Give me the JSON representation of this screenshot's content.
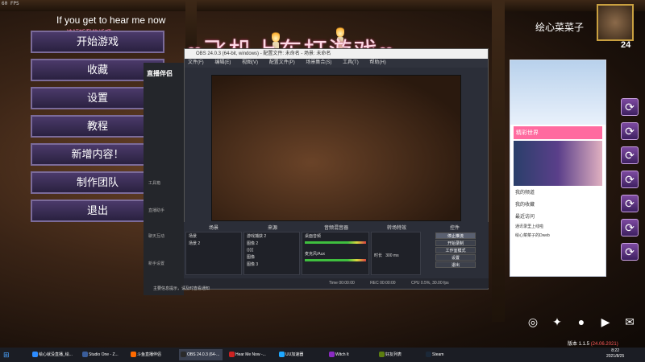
{
  "stream_overlay": {
    "fps": "60 FPS",
    "banner_text": "If you get to hear me now",
    "banner_subtext": "请倾听我的话吧",
    "title": "飞机上车打游戏",
    "player_name": "绘心菜菜子",
    "player_level": "24"
  },
  "game_menu": {
    "items": [
      {
        "label": "开始游戏"
      },
      {
        "label": "收藏"
      },
      {
        "label": "设置"
      },
      {
        "label": "教程"
      },
      {
        "label": "新增内容！"
      },
      {
        "label": "制作团队"
      },
      {
        "label": "退出"
      }
    ]
  },
  "streaming_app": {
    "logo_text": "直播伴侣",
    "nav": [
      "工具箱",
      "直播助手",
      "聊天互动",
      "新手设置"
    ],
    "notice": "主要信息提示，请及时查看通知",
    "stats": [
      "Time 00:00:00",
      "REC 00:00:00",
      "CPU 0.5%, 30.00 fps"
    ]
  },
  "obs": {
    "window_title": "OBS 24.0.3 (64-bit, windows) - 配置文件: 未命名 - 场景: 未命名",
    "menu": [
      "文件(F)",
      "编辑(E)",
      "视图(V)",
      "配置文件(P)",
      "场景集合(S)",
      "工具(T)",
      "帮助(H)"
    ],
    "docks": {
      "scenes": {
        "header": "场景",
        "items": [
          "场景",
          "场景 2"
        ]
      },
      "sources": {
        "header": "来源",
        "items": [
          "游戏捕获 2",
          "图像 2",
          "(((((",
          "图像",
          "图像 3"
        ]
      },
      "mixer": {
        "header": "音频混音器",
        "items": [
          "桌面音频",
          "麦克风/Aux"
        ]
      },
      "transitions": {
        "header": "转场特效",
        "duration_label": "时长",
        "duration": "300 ms"
      },
      "controls": {
        "header": "控件",
        "buttons": [
          "停止推流",
          "开始录制",
          "工作室模式",
          "设置",
          "退出"
        ]
      }
    }
  },
  "qq_panel": {
    "banner": "精彩世界",
    "items": [
      "我的频道",
      "我的收藏",
      "最近访问"
    ],
    "chats": [
      "通讯录里上线啦",
      "绘心菜菜子的Dweb"
    ]
  },
  "version": {
    "label": "版本 1.1.5",
    "date": "(24.06.2021)"
  },
  "taskbar": {
    "items": [
      {
        "label": "绘心就没直播_绘...",
        "icon": "#2d8cff"
      },
      {
        "label": "Studio One - Z...",
        "icon": "#3a5d9a"
      },
      {
        "label": "斗鱼直播伴侣",
        "icon": "#ff6a00"
      },
      {
        "label": "OBS 24.0.3 (64-...",
        "icon": "#2a2a2a"
      },
      {
        "label": "Hear Me Now -...",
        "icon": "#c22"
      },
      {
        "label": "UU加速器",
        "icon": "#1fa8ff"
      },
      {
        "label": "Witch It",
        "icon": "#8a2ac2"
      },
      {
        "label": "好友列表",
        "icon": "#5c7e10"
      },
      {
        "label": "Steam",
        "icon": "#1b2838"
      }
    ],
    "time": "8:22",
    "date": "2021/8/25"
  }
}
